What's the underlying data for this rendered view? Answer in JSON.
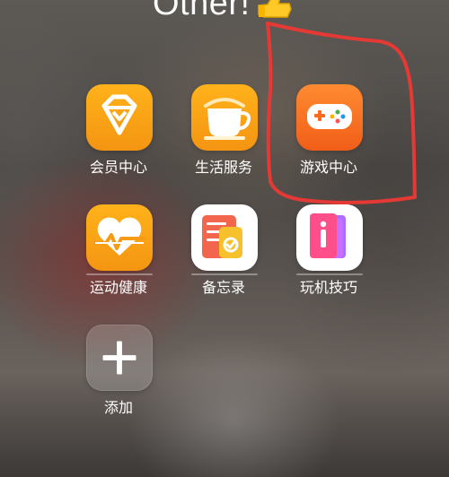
{
  "folder": {
    "title": "Other!",
    "title_emoji": "thumb-icon"
  },
  "apps": [
    {
      "label": "会员中心",
      "icon": "diamond-icon"
    },
    {
      "label": "生活服务",
      "icon": "coffee-cup-icon"
    },
    {
      "label": "游戏中心",
      "icon": "game-controller-icon"
    },
    {
      "label": "运动健康",
      "icon": "heart-pulse-icon"
    },
    {
      "label": "备忘录",
      "icon": "memo-icon"
    },
    {
      "label": "玩机技巧",
      "icon": "tips-icon"
    },
    {
      "label": "添加",
      "icon": "plus-icon"
    }
  ],
  "annotation": {
    "highlighted_app": "游戏中心",
    "color": "#e53935"
  }
}
